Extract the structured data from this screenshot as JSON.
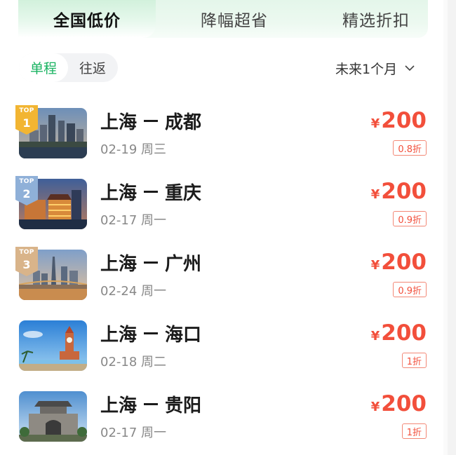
{
  "tabs": [
    {
      "label": "全国低价",
      "active": true
    },
    {
      "label": "降幅超省",
      "active": false
    },
    {
      "label": "精选折扣",
      "active": false
    }
  ],
  "trip_type": {
    "one_way": "单程",
    "round_trip": "往返",
    "selected": "单程"
  },
  "date_filter": {
    "label": "未来1个月",
    "icon": "chevron-down-icon"
  },
  "colors": {
    "accent_green": "#19b361",
    "price_red": "#f24f3b"
  },
  "flights": [
    {
      "rank": "1",
      "badge": "TOP",
      "from": "上海",
      "to": "成都",
      "date": "02-19 周三",
      "currency": "¥",
      "price": "200",
      "discount": "0.8折",
      "image": "chengdu-skyline"
    },
    {
      "rank": "2",
      "badge": "TOP",
      "from": "上海",
      "to": "重庆",
      "date": "02-17 周一",
      "currency": "¥",
      "price": "200",
      "discount": "0.9折",
      "image": "chongqing-hongyadong"
    },
    {
      "rank": "3",
      "badge": "TOP",
      "from": "上海",
      "to": "广州",
      "date": "02-24 周一",
      "currency": "¥",
      "price": "200",
      "discount": "0.9折",
      "image": "guangzhou-skyline"
    },
    {
      "from": "上海",
      "to": "海口",
      "date": "02-18 周二",
      "currency": "¥",
      "price": "200",
      "discount": "1折",
      "image": "haikou-clock-tower"
    },
    {
      "from": "上海",
      "to": "贵阳",
      "date": "02-17 周一",
      "currency": "¥",
      "price": "200",
      "discount": "1折",
      "image": "guiyang-gate"
    }
  ]
}
